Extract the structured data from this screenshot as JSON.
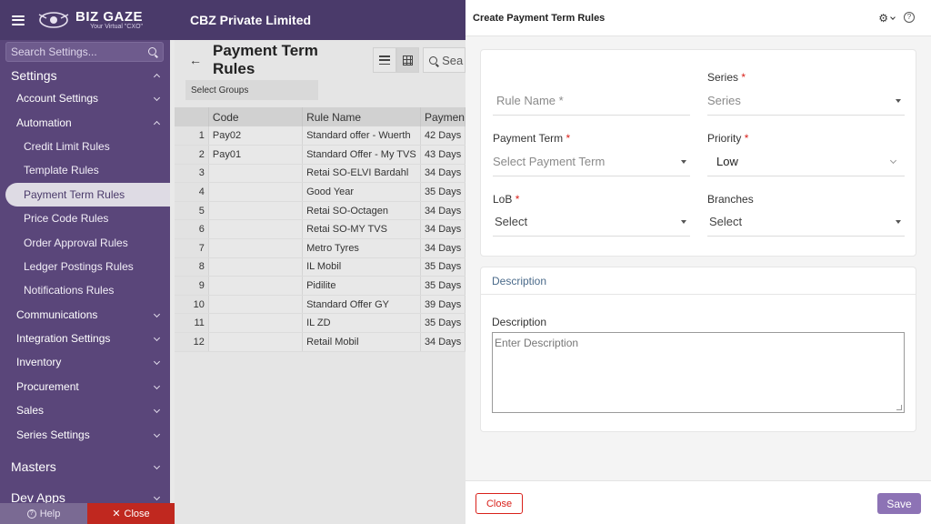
{
  "app": {
    "logo_main": "BIZ GAZE",
    "logo_sub": "Your Virtual \"CXO\"",
    "company": "CBZ Private Limited"
  },
  "sidebar": {
    "search_placeholder": "Search Settings...",
    "settings_label": "Settings",
    "account_settings": "Account Settings",
    "automation": "Automation",
    "automation_items": [
      "Credit Limit Rules",
      "Template Rules",
      "Payment Term Rules",
      "Price Code Rules",
      "Order Approval Rules",
      "Ledger Postings Rules",
      "Notifications Rules"
    ],
    "groups": [
      "Communications",
      "Integration Settings",
      "Inventory",
      "Procurement",
      "Sales",
      "Series Settings"
    ],
    "masters": "Masters",
    "dev_apps": "Dev Apps",
    "help_label": "Help",
    "close_label": "Close"
  },
  "list": {
    "title": "Payment Term Rules",
    "search_text": "Sea",
    "select_groups": "Select Groups",
    "columns": [
      "",
      "Code",
      "Rule Name",
      "Paymen"
    ],
    "rows": [
      [
        "1",
        "Pay02",
        "Standard offer - Wuerth",
        "42 Days"
      ],
      [
        "2",
        "Pay01",
        "Standard Offer - My TVS",
        "43 Days"
      ],
      [
        "3",
        "",
        "Retai SO-ELVI Bardahl",
        "34 Days"
      ],
      [
        "4",
        "",
        "Good Year",
        "35 Days"
      ],
      [
        "5",
        "",
        "Retai SO-Octagen",
        "34 Days"
      ],
      [
        "6",
        "",
        "Retai SO-MY TVS",
        "34 Days"
      ],
      [
        "7",
        "",
        "Metro Tyres",
        "34 Days"
      ],
      [
        "8",
        "",
        "IL Mobil",
        "35 Days"
      ],
      [
        "9",
        "",
        "Pidilite",
        "35 Days"
      ],
      [
        "10",
        "",
        "Standard Offer GY",
        "39 Days"
      ],
      [
        "11",
        "",
        "IL ZD",
        "35 Days"
      ],
      [
        "12",
        "",
        "Retail Mobil",
        "34 Days"
      ]
    ]
  },
  "panel": {
    "title": "Create Payment Term Rules",
    "rule_name_placeholder": "Rule Name *",
    "series_label": "Series",
    "series_placeholder": "Series",
    "payment_term_label": "Payment Term",
    "payment_term_placeholder": "Select Payment Term",
    "priority_label": "Priority",
    "priority_value": "Low",
    "lob_label": "LoB",
    "lob_placeholder": "Select",
    "branches_label": "Branches",
    "branches_placeholder": "Select",
    "required_mark": "*",
    "description_section": "Description",
    "description_label": "Description",
    "description_placeholder": "Enter Description",
    "close_button": "Close",
    "save_button": "Save"
  },
  "colors": {
    "brand_dark": "#4a3a6a",
    "sidebar": "#5a467a",
    "save": "#8d73b5",
    "danger": "#d9211b"
  }
}
